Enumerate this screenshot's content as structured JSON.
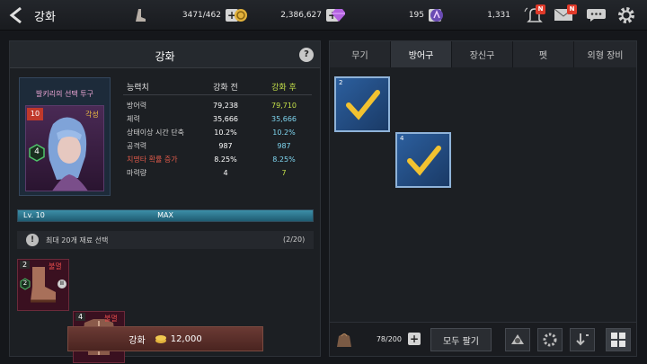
{
  "header": {
    "title": "강화",
    "stamina": "3471/462",
    "gold": "2,386,627",
    "gems": "195",
    "tickets": "1,331",
    "badge_n": "N"
  },
  "left": {
    "panel_title": "강화",
    "help": "?",
    "item_name": "발키리의 선택 투구",
    "item_level": "10",
    "item_tag": "각성",
    "item_grade": "4",
    "stats_header": {
      "label": "능력치",
      "before": "강화 전",
      "after": "강화 후"
    },
    "stats": [
      {
        "label": "방어력",
        "before": "79,238",
        "after": "79,710"
      },
      {
        "label": "체력",
        "before": "35,666",
        "after": "35,666"
      },
      {
        "label": "상태이상 시간 단축",
        "before": "10.2%",
        "after": "10.2%"
      },
      {
        "label": "공격력",
        "before": "987",
        "after": "987"
      },
      {
        "label": "치명타 확률 증가",
        "before": "8.25%",
        "after": "8.25%"
      },
      {
        "label": "마력량",
        "before": "4",
        "after": "7"
      }
    ],
    "level_label": "Lv. 10",
    "level_max": "MAX",
    "level_progress": 1.0,
    "material_notice": "최대 20개 재료 선택",
    "material_count": "(2/20)",
    "materials": [
      {
        "count": "2",
        "tag": "불멸",
        "grade": "2"
      },
      {
        "count": "4",
        "tag": "불멸",
        "grade": "4"
      }
    ],
    "enhance_label": "강화",
    "enhance_cost": "12,000"
  },
  "right": {
    "tabs": [
      "무기",
      "방어구",
      "장신구",
      "펫",
      "외형 장비"
    ],
    "active_tab": 1,
    "items": [
      {
        "grade": "2"
      },
      {
        "grade": "4"
      }
    ],
    "inventory": "78/200",
    "sell_all": "모두 팔기"
  },
  "colors": {
    "accent_green": "#c4e04a",
    "accent_cyan": "#7fd6f0",
    "red": "#e04a4a",
    "gold": "#e2b23c"
  }
}
